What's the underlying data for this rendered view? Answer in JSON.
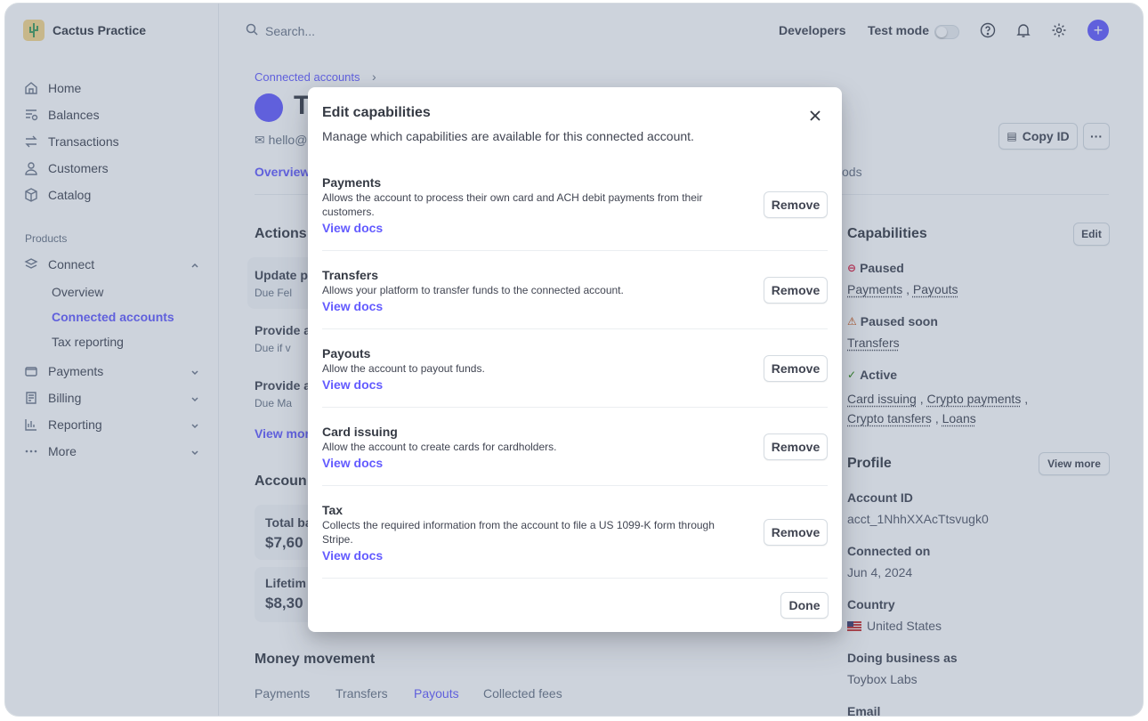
{
  "brand": {
    "name": "Cactus Practice"
  },
  "sidebar": {
    "items": [
      {
        "label": "Home"
      },
      {
        "label": "Balances"
      },
      {
        "label": "Transactions"
      },
      {
        "label": "Customers"
      },
      {
        "label": "Catalog"
      }
    ],
    "products_label": "Products",
    "connect": {
      "label": "Connect",
      "sub": [
        "Overview",
        "Connected accounts",
        "Tax reporting"
      ]
    },
    "groups": [
      {
        "label": "Payments"
      },
      {
        "label": "Billing"
      },
      {
        "label": "Reporting"
      },
      {
        "label": "More"
      }
    ]
  },
  "topbar": {
    "search_placeholder": "Search...",
    "developers": "Developers",
    "test_mode": "Test mode"
  },
  "page": {
    "breadcrumb": "Connected accounts",
    "account_initial": "T",
    "email_partial": "hello@",
    "tab_overview": "Overview",
    "tab_methods_partial": "ods",
    "copy_id": "Copy ID",
    "actions_heading": "Actions",
    "actions": [
      {
        "title": "Update p",
        "due": "Due Fel"
      },
      {
        "title": "Provide a",
        "due": "Due if v"
      },
      {
        "title": "Provide a",
        "due": "Due Ma"
      }
    ],
    "view_more_partial": "View mor",
    "account_heading_partial": "Accoun",
    "balances": [
      {
        "label": "Total ba",
        "value": "$7,60"
      },
      {
        "label": "Lifetim",
        "value": "$8,30"
      }
    ],
    "money_movement": "Money movement",
    "mm_tabs": [
      "Payments",
      "Transfers",
      "Payouts",
      "Collected fees"
    ]
  },
  "capabilities_panel": {
    "heading": "Capabilities",
    "edit": "Edit",
    "paused": {
      "label": "Paused",
      "items": [
        "Payments",
        "Payouts"
      ]
    },
    "paused_soon": {
      "label": "Paused soon",
      "items": [
        "Transfers"
      ]
    },
    "active": {
      "label": "Active",
      "items": [
        "Card issuing",
        "Crypto payments",
        "Crypto tansfers",
        "Loans"
      ]
    }
  },
  "profile": {
    "heading": "Profile",
    "view_more": "View more",
    "account_id_label": "Account ID",
    "account_id": "acct_1NhhXXAcTtsvugk0",
    "connected_on_label": "Connected on",
    "connected_on": "Jun 4, 2024",
    "country_label": "Country",
    "country": "United States",
    "dba_label": "Doing business as",
    "dba": "Toybox Labs",
    "email_label": "Email"
  },
  "modal": {
    "title": "Edit capabilities",
    "subtitle": "Manage which capabilities are available for this connected account.",
    "remove_label": "Remove",
    "docs_label": "View docs",
    "done_label": "Done",
    "capabilities": [
      {
        "title": "Payments",
        "desc": "Allows the account to process their own card and ACH debit payments from their customers."
      },
      {
        "title": "Transfers",
        "desc": "Allows your platform to transfer funds to the connected account."
      },
      {
        "title": "Payouts",
        "desc": "Allow the account to payout funds."
      },
      {
        "title": "Card issuing",
        "desc": "Allow the account to create cards for cardholders."
      },
      {
        "title": "Tax",
        "desc": "Collects the required information from the account to file a US 1099-K form through Stripe."
      }
    ]
  },
  "colors": {
    "accent": "#635bff",
    "paused": "#df1b41",
    "warning": "#c84801",
    "active": "#228403"
  }
}
